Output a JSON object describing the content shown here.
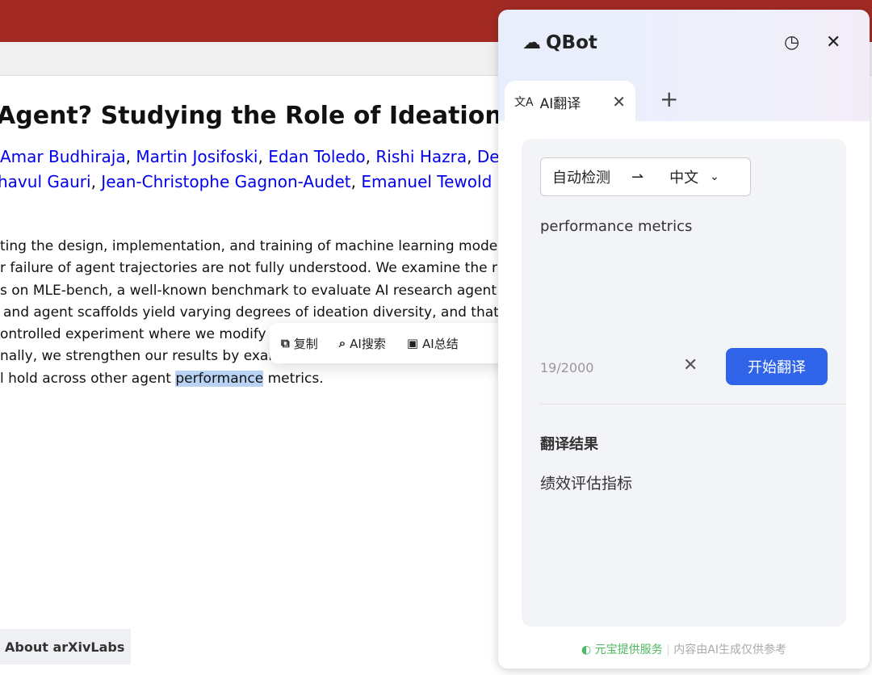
{
  "page": {
    "title": "Agent? Studying the Role of Ideation Dive",
    "authors_line1": [
      "Amar Budhiraja",
      "Martin Josifoski",
      "Edan Toledo",
      "Rishi Hazra",
      "De"
    ],
    "authors_line2": [
      "havul Gauri",
      "Jean-Christophe Gagnon-Audet",
      "Emanuel Tewold"
    ],
    "abstract": [
      "ting the design, implementation, and training of machine learning mode",
      "r failure of agent trajectories are not fully understood. We examine the r",
      "s on MLE-bench, a well-known benchmark to evaluate AI research agent",
      "and agent scaffolds yield varying degrees of ideation diversity, and that",
      "ontrolled experiment where we modify",
      "nally, we strengthen our results by exar"
    ],
    "last_pre": "l hold across other agent ",
    "last_hl": "performance",
    "last_post": " metrics.",
    "about": "About arXivLabs"
  },
  "popup": {
    "copy": "复制",
    "search": "AI搜索",
    "summary": "AI总结"
  },
  "qbot": {
    "name": "QBot",
    "tab": "AI翻译",
    "source_lang": "自动检测",
    "arrow": "⇀",
    "target_lang": "中文",
    "input": "performance metrics",
    "count": "19/2000",
    "translate_button": "开始翻译",
    "result_label": "翻译结果",
    "result": "绩效评估指标",
    "footer_provider": "元宝提供服务",
    "footer_note": "内容由AI生成仅供参考"
  }
}
